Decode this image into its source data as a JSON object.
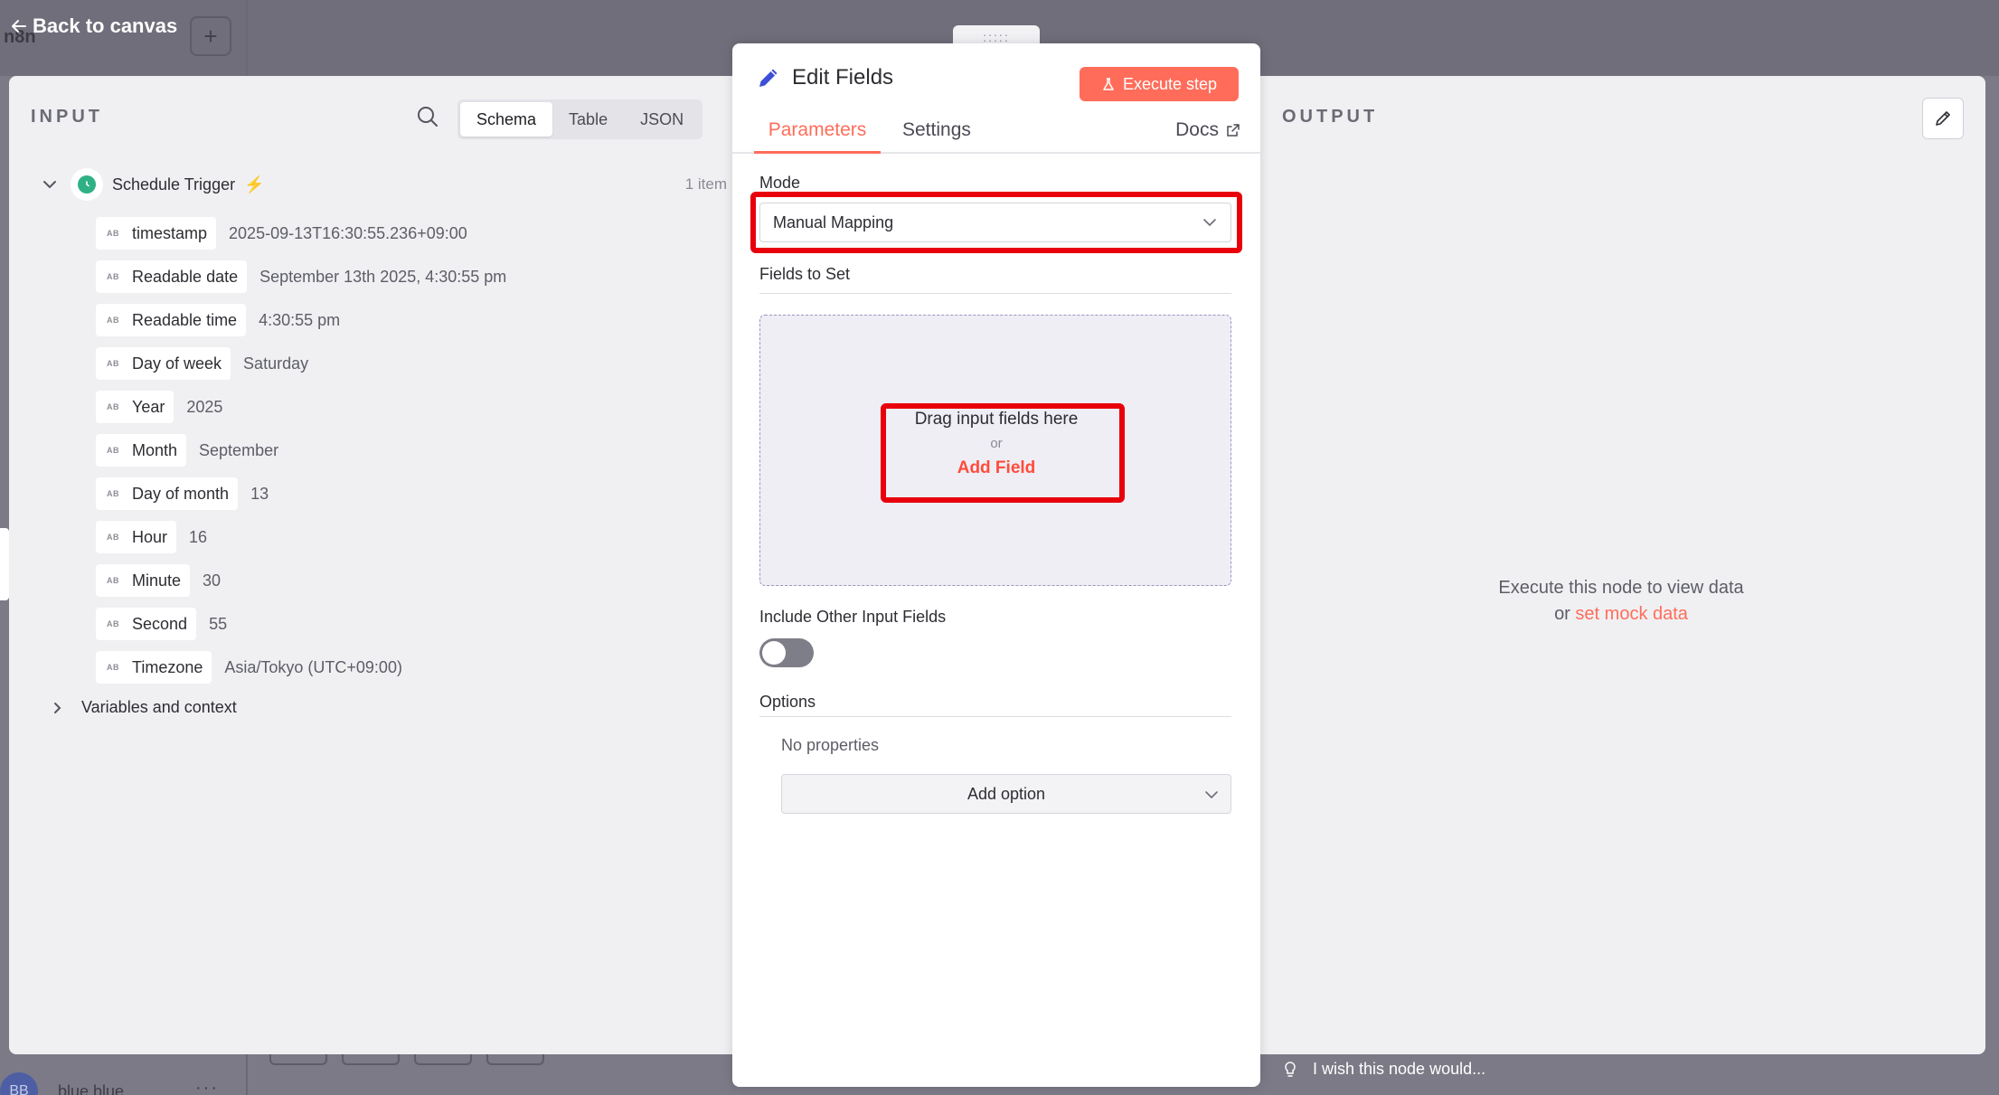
{
  "nav": {
    "back_label": "Back to canvas",
    "app_name": "n8n"
  },
  "background": {
    "user_initials": "BB",
    "user_name": "blue blue",
    "more": "···"
  },
  "input_panel": {
    "title": "INPUT",
    "view_tabs": [
      "Schema",
      "Table",
      "JSON"
    ],
    "active_view": "Schema",
    "trigger": {
      "name": "Schedule Trigger",
      "count": "1 item"
    },
    "type_badge": "AB",
    "fields": [
      {
        "key": "timestamp",
        "value": "2025-09-13T16:30:55.236+09:00"
      },
      {
        "key": "Readable date",
        "value": "September 13th 2025, 4:30:55 pm"
      },
      {
        "key": "Readable time",
        "value": "4:30:55 pm"
      },
      {
        "key": "Day of week",
        "value": "Saturday"
      },
      {
        "key": "Year",
        "value": "2025"
      },
      {
        "key": "Month",
        "value": "September"
      },
      {
        "key": "Day of month",
        "value": "13"
      },
      {
        "key": "Hour",
        "value": "16"
      },
      {
        "key": "Minute",
        "value": "30"
      },
      {
        "key": "Second",
        "value": "55"
      },
      {
        "key": "Timezone",
        "value": "Asia/Tokyo (UTC+09:00)"
      }
    ],
    "variables_label": "Variables and context"
  },
  "node": {
    "handle": ":::::",
    "title": "Edit Fields",
    "execute_label": "Execute step",
    "tabs": [
      "Parameters",
      "Settings"
    ],
    "docs_label": "Docs",
    "mode_label": "Mode",
    "mode_value": "Manual Mapping",
    "fields_to_set_label": "Fields to Set",
    "drop_text": "Drag input fields here",
    "or_text": "or",
    "add_field_label": "Add Field",
    "include_label": "Include Other Input Fields",
    "include_enabled": false,
    "options_label": "Options",
    "no_properties": "No properties",
    "add_option_label": "Add option"
  },
  "output_panel": {
    "title": "OUTPUT",
    "empty_line1": "Execute this node to view data",
    "empty_or": "or",
    "mock_link": "set mock data"
  },
  "feedback": {
    "wish_label": "I wish this node would..."
  },
  "colors": {
    "accent": "#ff6d5a",
    "highlight": "#e8000b",
    "trigger_green": "#2fb085",
    "icon_blue": "#3d4fd6"
  }
}
